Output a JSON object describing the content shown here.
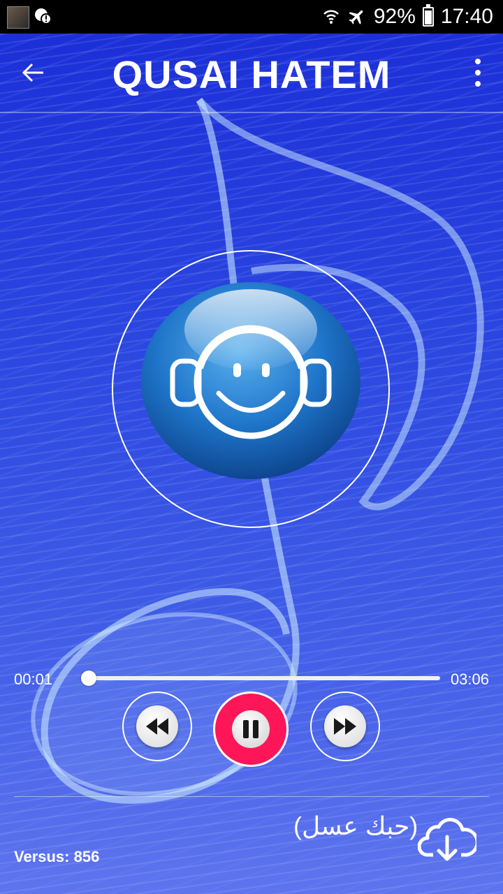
{
  "status_bar": {
    "battery_percent": "92%",
    "time": "17:40",
    "icons": [
      "thumbnail-icon",
      "alert-icon",
      "wifi-icon",
      "airplane-icon",
      "battery-icon"
    ]
  },
  "app_bar": {
    "title": "QUSAI HATEM",
    "back_icon": "arrow-left-icon",
    "menu_icon": "more-vertical-icon"
  },
  "player": {
    "current_time": "00:01",
    "total_time": "03:06",
    "progress": 0.005,
    "song_title": "(حبك عسل)",
    "accent_color": "#ff1659"
  },
  "footer": {
    "version": "Versus: 856"
  }
}
